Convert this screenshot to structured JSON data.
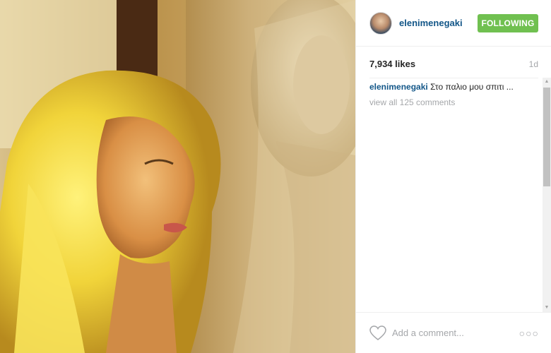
{
  "post": {
    "username": "elenimenegaki",
    "follow_label": "FOLLOWING",
    "likes": "7,934 likes",
    "time": "1d",
    "caption_user": "elenimenegaki",
    "caption_text": "Στο παλιο μου σπιτι ...",
    "view_all_comments": "view all 125 comments",
    "comment_placeholder": "Add a comment...",
    "more_label": "○○○"
  },
  "colors": {
    "link": "#125688",
    "follow_bg": "#70c050",
    "muted": "#a5a7aa"
  },
  "icons": {
    "heart": "heart-icon",
    "more": "more-options-icon"
  }
}
